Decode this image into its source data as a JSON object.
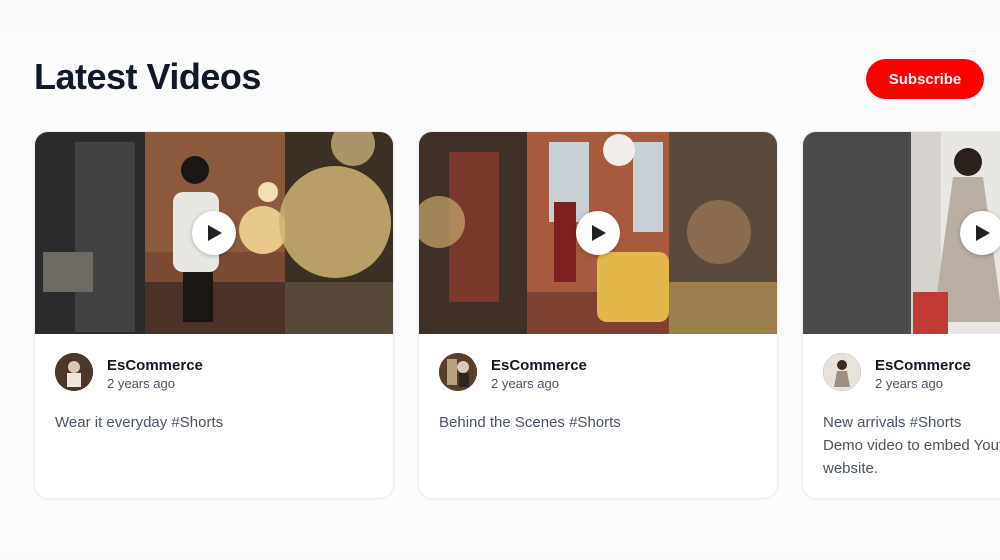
{
  "section": {
    "title": "Latest Videos",
    "subscribe_label": "Subscribe"
  },
  "colors": {
    "accent": "#ff0000",
    "background": "#fafafa",
    "card": "#ffffff"
  },
  "videos": [
    {
      "channel": "EsCommerce",
      "time": "2 years ago",
      "description": "Wear it everyday #Shorts",
      "icon": "play-icon"
    },
    {
      "channel": "EsCommerce",
      "time": "2 years ago",
      "description": "Behind the Scenes #Shorts",
      "icon": "play-icon"
    },
    {
      "channel": "EsCommerce",
      "time": "2 years ago",
      "description": "New arrivals #Shorts\nDemo video to embed Yout\nwebsite.",
      "icon": "play-icon"
    }
  ]
}
